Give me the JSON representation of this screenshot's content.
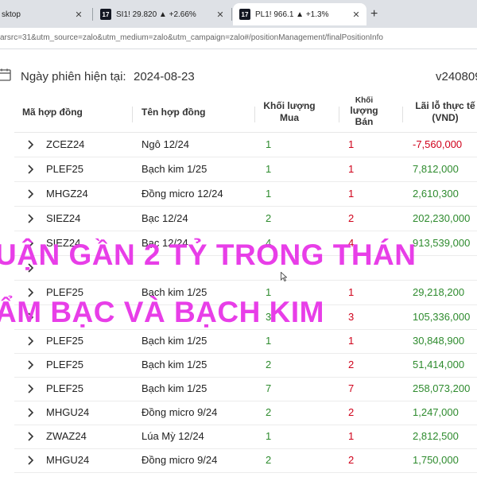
{
  "browser": {
    "tabs": [
      {
        "label": "sktop",
        "icon": ""
      },
      {
        "label": "SI1! 29.820 ▲ +2.66%",
        "icon": "17"
      },
      {
        "label": "PL1! 966.1 ▲ +1.3%",
        "icon": "17"
      }
    ],
    "new_tab": "+",
    "url": "arsrc=31&utm_source=zalo&utm_medium=zalo&utm_campaign=zalo#/positionManagement/finalPositionInfo"
  },
  "session": {
    "label": "Ngày phiên hiện tại:",
    "date": "2024-08-23",
    "version": "v240809"
  },
  "table": {
    "headers": {
      "code": "Mã hợp đồng",
      "name": "Tên hợp đồng",
      "buy_1": "Khối lượng",
      "buy_2": "Mua",
      "sell_1": "Khối",
      "sell_2": "lượng",
      "sell_3": "Bán",
      "pnl_1": "Lãi lỗ thực tế",
      "pnl_2": "(VND)"
    },
    "rows": [
      {
        "code": "ZCEZ24",
        "name": "Ngô 12/24",
        "buy": "1",
        "sell": "1",
        "pnl": "-7,560,000"
      },
      {
        "code": "PLEF25",
        "name": "Bạch kim 1/25",
        "buy": "1",
        "sell": "1",
        "pnl": "7,812,000"
      },
      {
        "code": "MHGZ24",
        "name": "Đồng micro 12/24",
        "buy": "1",
        "sell": "1",
        "pnl": "2,610,300"
      },
      {
        "code": "SIEZ24",
        "name": "Bạc 12/24",
        "buy": "2",
        "sell": "2",
        "pnl": "202,230,000"
      },
      {
        "code": "SIEZ24",
        "name": "Bạc 12/24",
        "buy": "4",
        "sell": "4",
        "pnl": "913,539,000"
      },
      {
        "code": "",
        "name": "",
        "buy": "",
        "sell": "",
        "pnl": ""
      },
      {
        "code": "PLEF25",
        "name": "Bạch kim 1/25",
        "buy": "1",
        "sell": "1",
        "pnl": "29,218,200"
      },
      {
        "code": "",
        "name": "",
        "buy": "3",
        "sell": "3",
        "pnl": "105,336,000"
      },
      {
        "code": "PLEF25",
        "name": "Bạch kim 1/25",
        "buy": "1",
        "sell": "1",
        "pnl": "30,848,900"
      },
      {
        "code": "PLEF25",
        "name": "Bạch kim 1/25",
        "buy": "2",
        "sell": "2",
        "pnl": "51,414,000"
      },
      {
        "code": "PLEF25",
        "name": "Bạch kim 1/25",
        "buy": "7",
        "sell": "7",
        "pnl": "258,073,200"
      },
      {
        "code": "MHGU24",
        "name": "Đồng micro 9/24",
        "buy": "2",
        "sell": "2",
        "pnl": "1,247,000"
      },
      {
        "code": "ZWAZ24",
        "name": "Lúa Mỳ 12/24",
        "buy": "1",
        "sell": "1",
        "pnl": "2,812,500"
      },
      {
        "code": "MHGU24",
        "name": "Đồng micro 9/24",
        "buy": "2",
        "sell": "2",
        "pnl": "1,750,000"
      }
    ]
  },
  "overlay": {
    "line1": "UẬN GẦN 2 TỶ TRONG THÁN",
    "line2": "ẨM BẠC VÀ BẠCH KIM"
  },
  "colors": {
    "buy": "#2e8b2e",
    "sell": "#d0021b",
    "overlay": "#e83ee8"
  }
}
